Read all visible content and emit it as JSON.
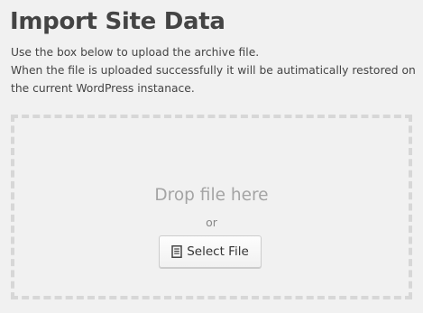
{
  "page": {
    "title": "Import Site Data",
    "description_lines": [
      "Use the box below to upload the archive file.",
      "When the file is uploaded successfully it will be autimatically restored on",
      "the current WordPress instanace."
    ]
  },
  "dropzone": {
    "drop_text": "Drop file here",
    "or_text": "or",
    "select_button_label": "Select File",
    "select_button_icon": "file-text-icon"
  },
  "colors": {
    "background": "#f1f1f1",
    "dropzone_border": "#d7d7d7",
    "drop_text": "#a4a4a4"
  }
}
